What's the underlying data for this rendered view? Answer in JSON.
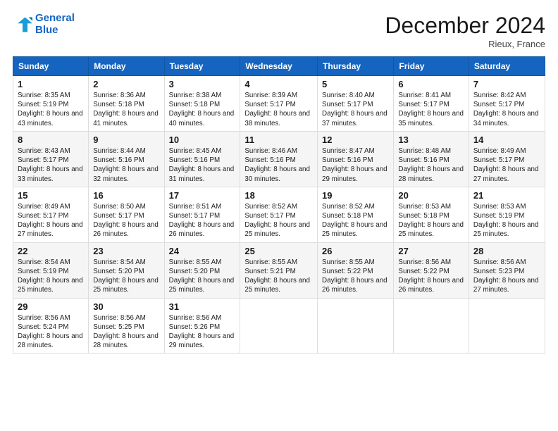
{
  "logo": {
    "line1": "General",
    "line2": "Blue"
  },
  "title": "December 2024",
  "location": "Rieux, France",
  "weekdays": [
    "Sunday",
    "Monday",
    "Tuesday",
    "Wednesday",
    "Thursday",
    "Friday",
    "Saturday"
  ],
  "weeks": [
    [
      {
        "day": "1",
        "sunrise": "8:35 AM",
        "sunset": "5:19 PM",
        "daylight": "8 hours and 43 minutes."
      },
      {
        "day": "2",
        "sunrise": "8:36 AM",
        "sunset": "5:18 PM",
        "daylight": "8 hours and 41 minutes."
      },
      {
        "day": "3",
        "sunrise": "8:38 AM",
        "sunset": "5:18 PM",
        "daylight": "8 hours and 40 minutes."
      },
      {
        "day": "4",
        "sunrise": "8:39 AM",
        "sunset": "5:17 PM",
        "daylight": "8 hours and 38 minutes."
      },
      {
        "day": "5",
        "sunrise": "8:40 AM",
        "sunset": "5:17 PM",
        "daylight": "8 hours and 37 minutes."
      },
      {
        "day": "6",
        "sunrise": "8:41 AM",
        "sunset": "5:17 PM",
        "daylight": "8 hours and 35 minutes."
      },
      {
        "day": "7",
        "sunrise": "8:42 AM",
        "sunset": "5:17 PM",
        "daylight": "8 hours and 34 minutes."
      }
    ],
    [
      {
        "day": "8",
        "sunrise": "8:43 AM",
        "sunset": "5:17 PM",
        "daylight": "8 hours and 33 minutes."
      },
      {
        "day": "9",
        "sunrise": "8:44 AM",
        "sunset": "5:16 PM",
        "daylight": "8 hours and 32 minutes."
      },
      {
        "day": "10",
        "sunrise": "8:45 AM",
        "sunset": "5:16 PM",
        "daylight": "8 hours and 31 minutes."
      },
      {
        "day": "11",
        "sunrise": "8:46 AM",
        "sunset": "5:16 PM",
        "daylight": "8 hours and 30 minutes."
      },
      {
        "day": "12",
        "sunrise": "8:47 AM",
        "sunset": "5:16 PM",
        "daylight": "8 hours and 29 minutes."
      },
      {
        "day": "13",
        "sunrise": "8:48 AM",
        "sunset": "5:16 PM",
        "daylight": "8 hours and 28 minutes."
      },
      {
        "day": "14",
        "sunrise": "8:49 AM",
        "sunset": "5:17 PM",
        "daylight": "8 hours and 27 minutes."
      }
    ],
    [
      {
        "day": "15",
        "sunrise": "8:49 AM",
        "sunset": "5:17 PM",
        "daylight": "8 hours and 27 minutes."
      },
      {
        "day": "16",
        "sunrise": "8:50 AM",
        "sunset": "5:17 PM",
        "daylight": "8 hours and 26 minutes."
      },
      {
        "day": "17",
        "sunrise": "8:51 AM",
        "sunset": "5:17 PM",
        "daylight": "8 hours and 26 minutes."
      },
      {
        "day": "18",
        "sunrise": "8:52 AM",
        "sunset": "5:17 PM",
        "daylight": "8 hours and 25 minutes."
      },
      {
        "day": "19",
        "sunrise": "8:52 AM",
        "sunset": "5:18 PM",
        "daylight": "8 hours and 25 minutes."
      },
      {
        "day": "20",
        "sunrise": "8:53 AM",
        "sunset": "5:18 PM",
        "daylight": "8 hours and 25 minutes."
      },
      {
        "day": "21",
        "sunrise": "8:53 AM",
        "sunset": "5:19 PM",
        "daylight": "8 hours and 25 minutes."
      }
    ],
    [
      {
        "day": "22",
        "sunrise": "8:54 AM",
        "sunset": "5:19 PM",
        "daylight": "8 hours and 25 minutes."
      },
      {
        "day": "23",
        "sunrise": "8:54 AM",
        "sunset": "5:20 PM",
        "daylight": "8 hours and 25 minutes."
      },
      {
        "day": "24",
        "sunrise": "8:55 AM",
        "sunset": "5:20 PM",
        "daylight": "8 hours and 25 minutes."
      },
      {
        "day": "25",
        "sunrise": "8:55 AM",
        "sunset": "5:21 PM",
        "daylight": "8 hours and 25 minutes."
      },
      {
        "day": "26",
        "sunrise": "8:55 AM",
        "sunset": "5:22 PM",
        "daylight": "8 hours and 26 minutes."
      },
      {
        "day": "27",
        "sunrise": "8:56 AM",
        "sunset": "5:22 PM",
        "daylight": "8 hours and 26 minutes."
      },
      {
        "day": "28",
        "sunrise": "8:56 AM",
        "sunset": "5:23 PM",
        "daylight": "8 hours and 27 minutes."
      }
    ],
    [
      {
        "day": "29",
        "sunrise": "8:56 AM",
        "sunset": "5:24 PM",
        "daylight": "8 hours and 28 minutes."
      },
      {
        "day": "30",
        "sunrise": "8:56 AM",
        "sunset": "5:25 PM",
        "daylight": "8 hours and 28 minutes."
      },
      {
        "day": "31",
        "sunrise": "8:56 AM",
        "sunset": "5:26 PM",
        "daylight": "8 hours and 29 minutes."
      },
      null,
      null,
      null,
      null
    ]
  ]
}
